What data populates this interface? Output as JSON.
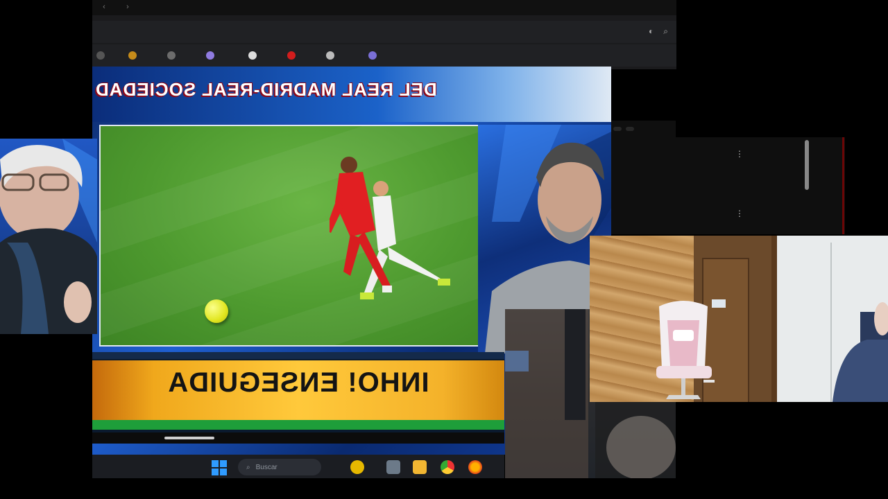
{
  "browser": {
    "url": "",
    "bookmarks": [
      "",
      "",
      "",
      "",
      "",
      "",
      "",
      ""
    ]
  },
  "broadcast": {
    "banner_title": "DEL REAL MADRID-REAL SOCIEDAD",
    "banner_handle": "",
    "lower_third_text": "INHO! ENSEGUIDA",
    "progress": 0.25
  },
  "youtube": {
    "chips": [
      "",
      ""
    ],
    "items": [
      {
        "title": "",
        "sub": ""
      },
      {
        "title": "",
        "sub": ""
      }
    ]
  },
  "taskbar": {
    "search_label": "Buscar"
  },
  "colors": {
    "banner_outline": "#8c0a1a",
    "lower_third_yellow": "#ffc93b",
    "lower_third_green": "#1e9e3a",
    "pitch_green": "#4e9a2f",
    "ball_yellow": "#e1e620"
  },
  "icons": [
    "back-icon",
    "forward-icon",
    "profile-icon",
    "search-icon",
    "windows-start-icon",
    "file-explorer-icon",
    "chrome-icon",
    "firefox-icon"
  ]
}
